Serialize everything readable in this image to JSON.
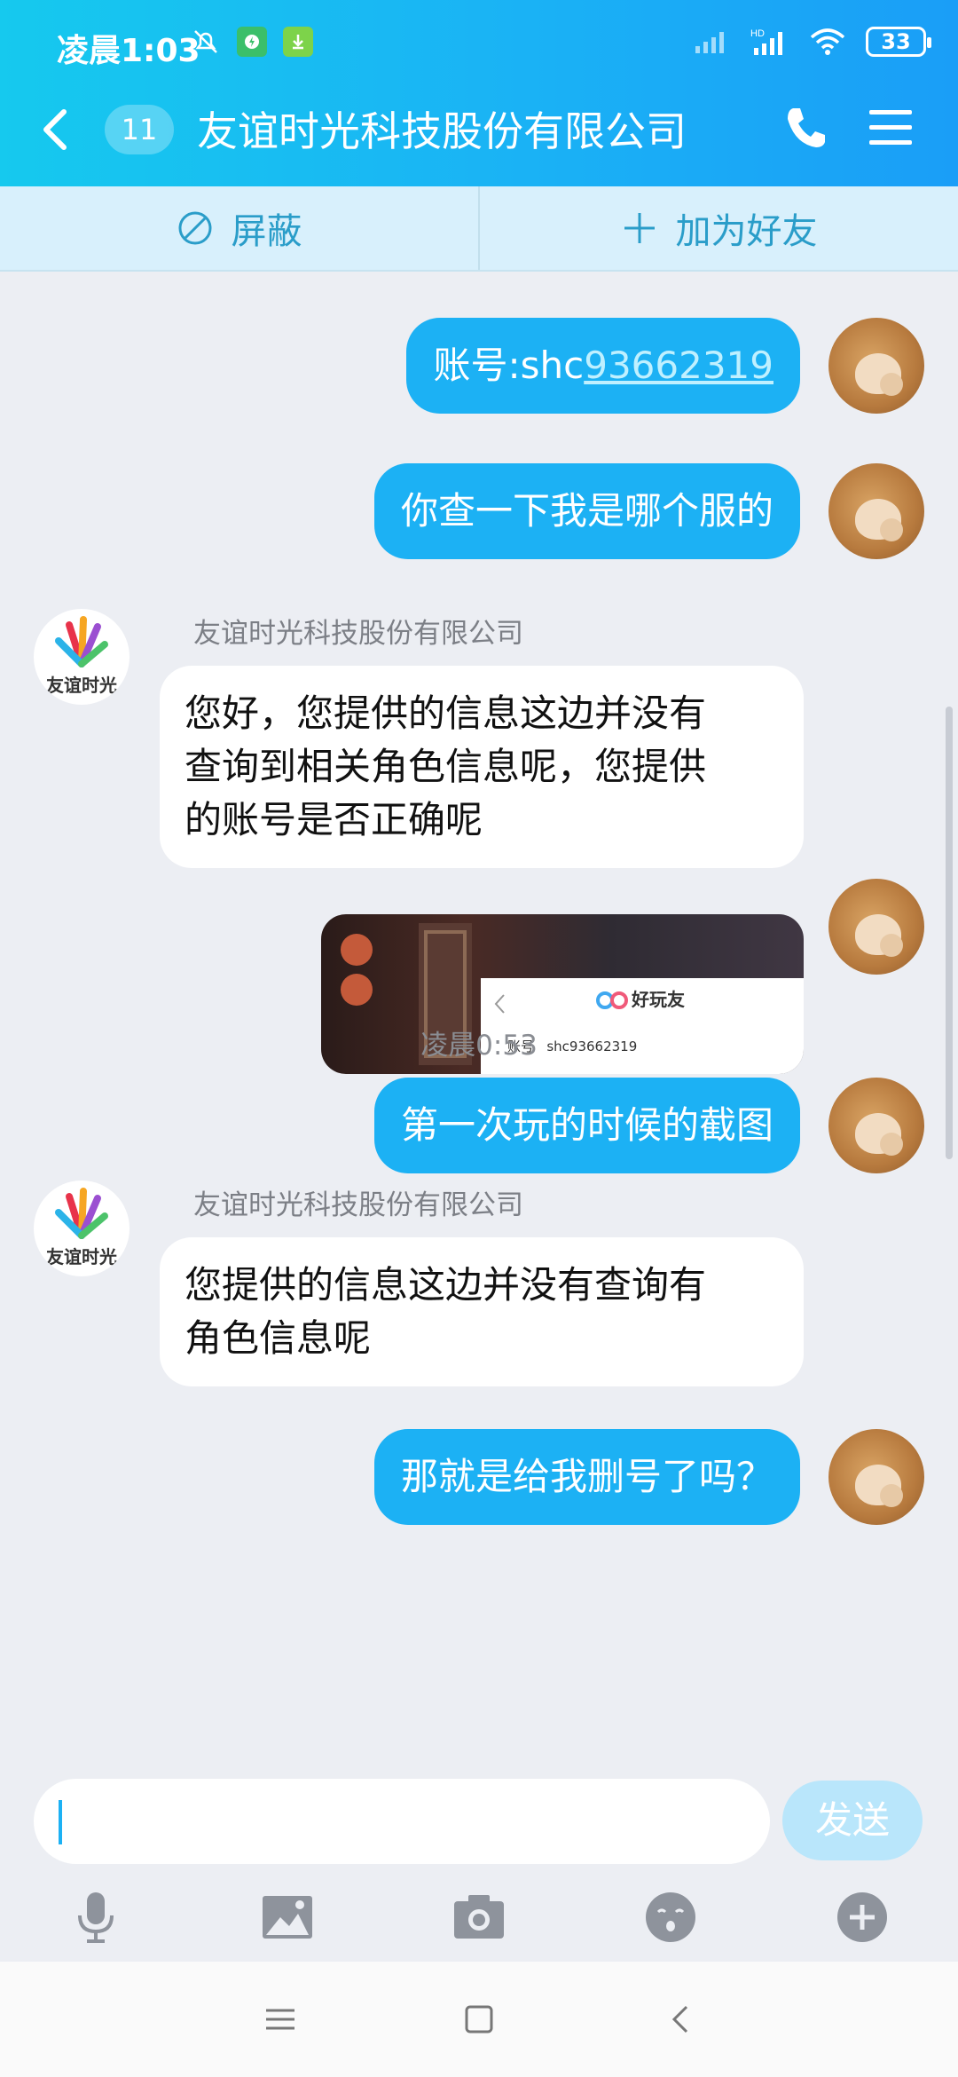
{
  "status_bar": {
    "time": "凌晨1:03",
    "battery": "33",
    "network": "HD"
  },
  "header": {
    "unread_count": "11",
    "title": "友谊时光科技股份有限公司"
  },
  "actions": {
    "block_label": "屏蔽",
    "add_friend_label": "加为好友"
  },
  "company": {
    "name": "友谊时光科技股份有限公司",
    "logo_text": "友谊时光"
  },
  "messages": {
    "m1_prefix": "账号:shc",
    "m1_link": "93662319",
    "m2": "你查一下我是哪个服的",
    "m3_line1": "您好，您提供的信息这边并没有",
    "m3_line2": "查询到相关角色信息呢，您提供",
    "m3_line3": "的账号是否正确呢",
    "m4_image": {
      "brand": "好玩友",
      "account_label": "账号",
      "account_value": "shc93662319"
    },
    "time_divider": "凌晨0:53",
    "m5": "第一次玩的时候的截图",
    "m6_line1": "您提供的信息这边并没有查询有",
    "m6_line2": "角色信息呢",
    "m7": "那就是给我删号了吗？"
  },
  "input": {
    "send_label": "发送",
    "value": ""
  },
  "toolbar_icons": [
    "microphone-icon",
    "image-icon",
    "camera-icon",
    "emoji-icon",
    "plus-icon"
  ],
  "colors": {
    "accent": "#1cb1f4",
    "header_start": "#16c9ee",
    "header_end": "#1a9ef7",
    "action_text": "#2a9dc9"
  }
}
